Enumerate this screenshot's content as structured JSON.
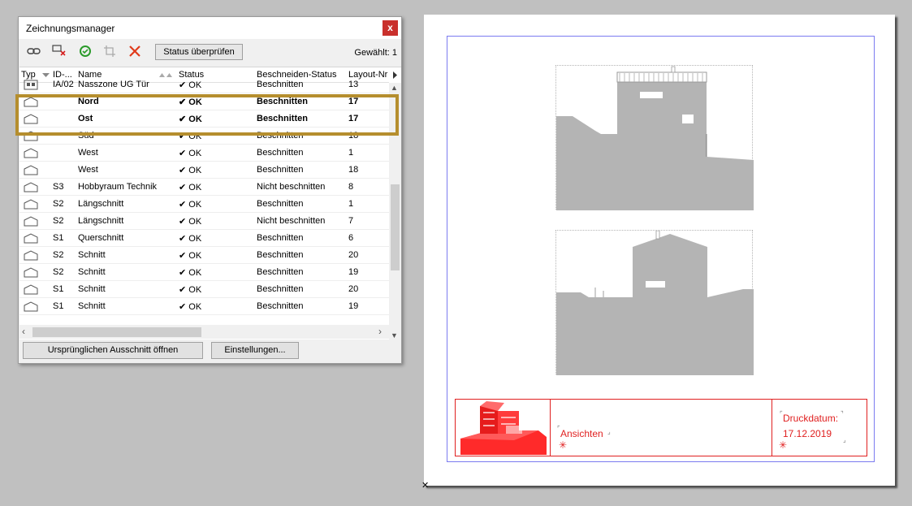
{
  "window": {
    "title": "Zeichnungsmanager",
    "close_glyph": "x"
  },
  "toolbar": {
    "icons": [
      "link-icon",
      "unlink-icon",
      "refresh-icon",
      "crop-icon",
      "delete-icon"
    ],
    "status_button": "Status überprüfen",
    "selected_label": "Gewählt: 1"
  },
  "columns": {
    "typ": "Typ",
    "id": "ID-...",
    "name": "Name",
    "status": "Status",
    "crop": "Beschneiden-Status",
    "layout": "Layout-Nr"
  },
  "rows": [
    {
      "id": "IA/02",
      "name": "Nasszone UG Tür",
      "status": "OK",
      "crop": "Beschnitten",
      "layout": "13"
    },
    {
      "id": "",
      "name": "Nord",
      "status": "OK",
      "crop": "Beschnitten",
      "layout": "17"
    },
    {
      "id": "",
      "name": "Ost",
      "status": "OK",
      "crop": "Beschnitten",
      "layout": "17"
    },
    {
      "id": "",
      "name": "Süd",
      "status": "OK",
      "crop": "Beschnitten",
      "layout": "18"
    },
    {
      "id": "",
      "name": "West",
      "status": "OK",
      "crop": "Beschnitten",
      "layout": "1"
    },
    {
      "id": "",
      "name": "West",
      "status": "OK",
      "crop": "Beschnitten",
      "layout": "18"
    },
    {
      "id": "S3",
      "name": "Hobbyraum Technik",
      "status": "OK",
      "crop": "Nicht beschnitten",
      "layout": "8"
    },
    {
      "id": "S2",
      "name": "Längschnitt",
      "status": "OK",
      "crop": "Beschnitten",
      "layout": "1"
    },
    {
      "id": "S2",
      "name": "Längschnitt",
      "status": "OK",
      "crop": "Nicht beschnitten",
      "layout": "7"
    },
    {
      "id": "S1",
      "name": "Querschnitt",
      "status": "OK",
      "crop": "Beschnitten",
      "layout": "6"
    },
    {
      "id": "S2",
      "name": "Schnitt",
      "status": "OK",
      "crop": "Beschnitten",
      "layout": "20"
    },
    {
      "id": "S2",
      "name": "Schnitt",
      "status": "OK",
      "crop": "Beschnitten",
      "layout": "19"
    },
    {
      "id": "S1",
      "name": "Schnitt",
      "status": "OK",
      "crop": "Beschnitten",
      "layout": "20"
    },
    {
      "id": "S1",
      "name": "Schnitt",
      "status": "OK",
      "crop": "Beschnitten",
      "layout": "19"
    }
  ],
  "buttons": {
    "open_original": "Ursprünglichen Ausschnitt öffnen",
    "settings": "Einstellungen..."
  },
  "titleblock": {
    "drawing_title": "Ansichten",
    "print_date_label": "Druckdatum:",
    "print_date": "17.12.2019"
  },
  "colors": {
    "highlight": "#b58e2e",
    "titleblock": "#e02020",
    "sheet_frame": "#7b7bf0"
  }
}
